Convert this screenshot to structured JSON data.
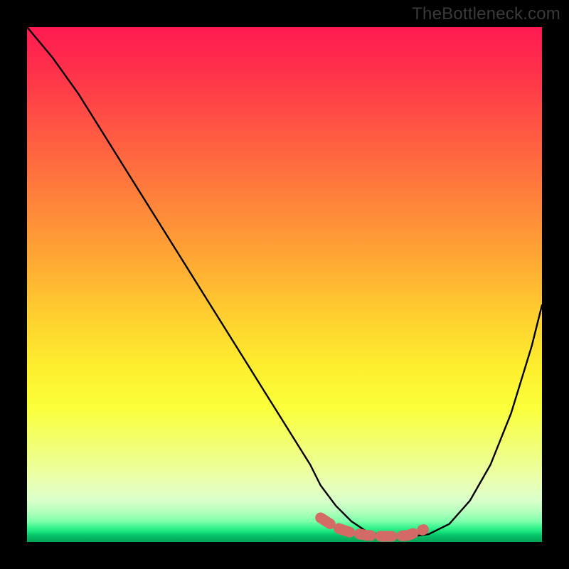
{
  "watermark": "TheBottleneck.com",
  "chart_data": {
    "type": "line",
    "title": "",
    "xlabel": "",
    "ylabel": "",
    "xlim": [
      0,
      100
    ],
    "ylim": [
      0,
      100
    ],
    "grid": false,
    "legend": false,
    "series": [
      {
        "name": "curve",
        "x": [
          0,
          5,
          10,
          15,
          20,
          25,
          30,
          35,
          40,
          45,
          50,
          55,
          57,
          60,
          63,
          66,
          69,
          72,
          74,
          78,
          82,
          86,
          90,
          94,
          98,
          100
        ],
        "y": [
          100,
          94,
          87,
          79,
          71,
          63,
          55,
          47,
          39,
          31,
          23,
          15,
          11,
          7,
          4,
          2,
          1.2,
          1.0,
          1.0,
          1.5,
          3.5,
          8,
          15,
          25,
          38,
          46
        ]
      }
    ],
    "highlight": {
      "name": "trough-marker",
      "color": "#d46a66",
      "x": [
        57,
        60,
        63,
        66,
        69,
        72,
        74,
        77
      ],
      "y": [
        4.7,
        2.8,
        1.8,
        1.3,
        1.1,
        1.1,
        1.3,
        2.4
      ]
    }
  }
}
